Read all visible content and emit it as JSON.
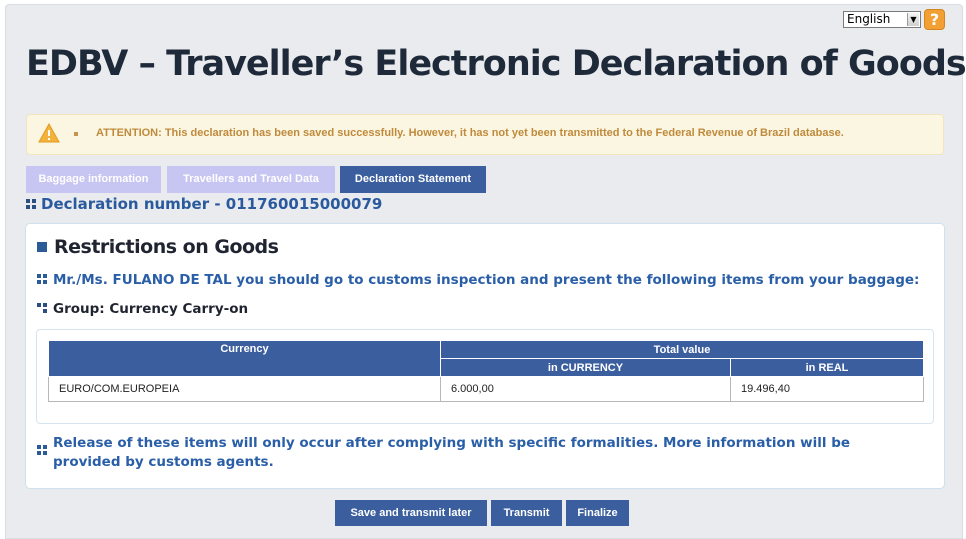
{
  "header": {
    "language_selected": "English",
    "help_label": "?",
    "title": "EDBV – Traveller’s Electronic Declaration of Goods"
  },
  "alert": {
    "icon": "warning-icon",
    "message": "ATTENTION: This declaration has been saved successfully. However, it has not yet been transmitted to the Federal Revenue of Brazil database."
  },
  "tabs": [
    {
      "label": "Baggage information",
      "active": false
    },
    {
      "label": "Travellers and Travel Data",
      "active": false
    },
    {
      "label": "Declaration Statement",
      "active": true
    }
  ],
  "declaration": {
    "number_text": "Declaration number - 011760015000079"
  },
  "restrictions": {
    "title": "Restrictions on Goods",
    "instruction": "Mr./Ms. FULANO DE TAL you should go to customs inspection and present the following items from your baggage:",
    "group": "Group: Currency Carry-on",
    "table": {
      "col_currency": "Currency",
      "col_total": "Total value",
      "sub_currency": "in CURRENCY",
      "sub_real": "in REAL",
      "rows": [
        {
          "currency": "EURO/COM.EUROPEIA",
          "in_currency": "6.000,00",
          "in_real": "19.496,40"
        }
      ]
    },
    "release_note": "Release of these items will only occur after complying with specific formalities. More information will be provided by customs agents."
  },
  "actions": {
    "save_later": "Save and transmit later",
    "transmit": "Transmit",
    "finalize": "Finalize"
  },
  "colors": {
    "primary": "#3b5e9e",
    "link_blue": "#2a5fa8",
    "warning_text": "#c08a3c",
    "warning_bg": "#fbf6e2",
    "inactive_tab": "#c7c5f1"
  }
}
